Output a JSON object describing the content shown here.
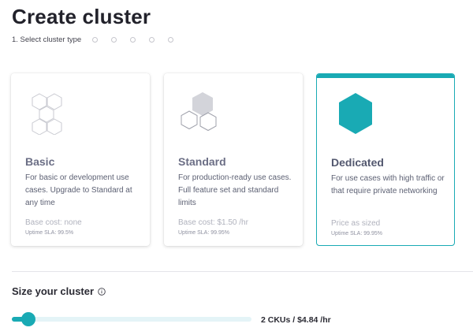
{
  "page": {
    "title": "Create cluster"
  },
  "stepper": {
    "current_label": "1. Select cluster type",
    "total_steps": 6,
    "current_step": 1
  },
  "cards": [
    {
      "name": "Basic",
      "description": "For basic or development use cases. Upgrade to Standard at any time",
      "cost": "Base cost: none",
      "sla": "Uptime SLA: 99.5%",
      "icon": "hexagon-outline-cluster-icon",
      "selected": false
    },
    {
      "name": "Standard",
      "description": "For production-ready use cases. Full feature set and standard limits",
      "cost": "Base cost: $1.50 /hr",
      "sla": "Uptime SLA: 99.95%",
      "icon": "hexagon-filled-cluster-icon",
      "selected": false
    },
    {
      "name": "Dedicated",
      "description": "For use cases with high traffic or that require private networking",
      "cost": "Price as sized",
      "sla": "Uptime SLA: 99.95%",
      "icon": "solid-hexagon-icon",
      "selected": true
    }
  ],
  "size": {
    "title": "Size your cluster",
    "info_icon": "info-icon",
    "slider_fraction": 0.07,
    "value_label": "2 CKUs / $4.84 /hr"
  },
  "colors": {
    "accent": "#19aab4",
    "track": "#e4f4f7",
    "muted_text": "#b0b2bd"
  }
}
